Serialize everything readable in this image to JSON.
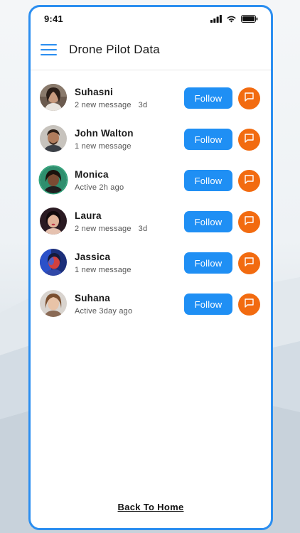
{
  "status_bar": {
    "time": "9:41",
    "icons": [
      "signal-icon",
      "wifi-icon",
      "battery-icon"
    ]
  },
  "header": {
    "title": "Drone Pilot Data",
    "menu_icon": "hamburger-menu-icon"
  },
  "users": [
    {
      "name": "Suhasni",
      "status": "2 new message",
      "time": "3d",
      "follow_label": "Follow"
    },
    {
      "name": "John Walton",
      "status": "1 new message",
      "time": "",
      "follow_label": "Follow"
    },
    {
      "name": "Monica",
      "status": "Active 2h ago",
      "time": "",
      "follow_label": "Follow"
    },
    {
      "name": "Laura",
      "status": "2 new message",
      "time": "3d",
      "follow_label": "Follow"
    },
    {
      "name": "Jassica",
      "status": "1 new message",
      "time": "",
      "follow_label": "Follow"
    },
    {
      "name": "Suhana",
      "status": "Active 3day ago",
      "time": "",
      "follow_label": "Follow"
    }
  ],
  "footer": {
    "back_label": "Back To Home"
  },
  "colors": {
    "accent": "#1f8ff4",
    "frame": "#2b8ef0",
    "chat": "#f26b10"
  }
}
